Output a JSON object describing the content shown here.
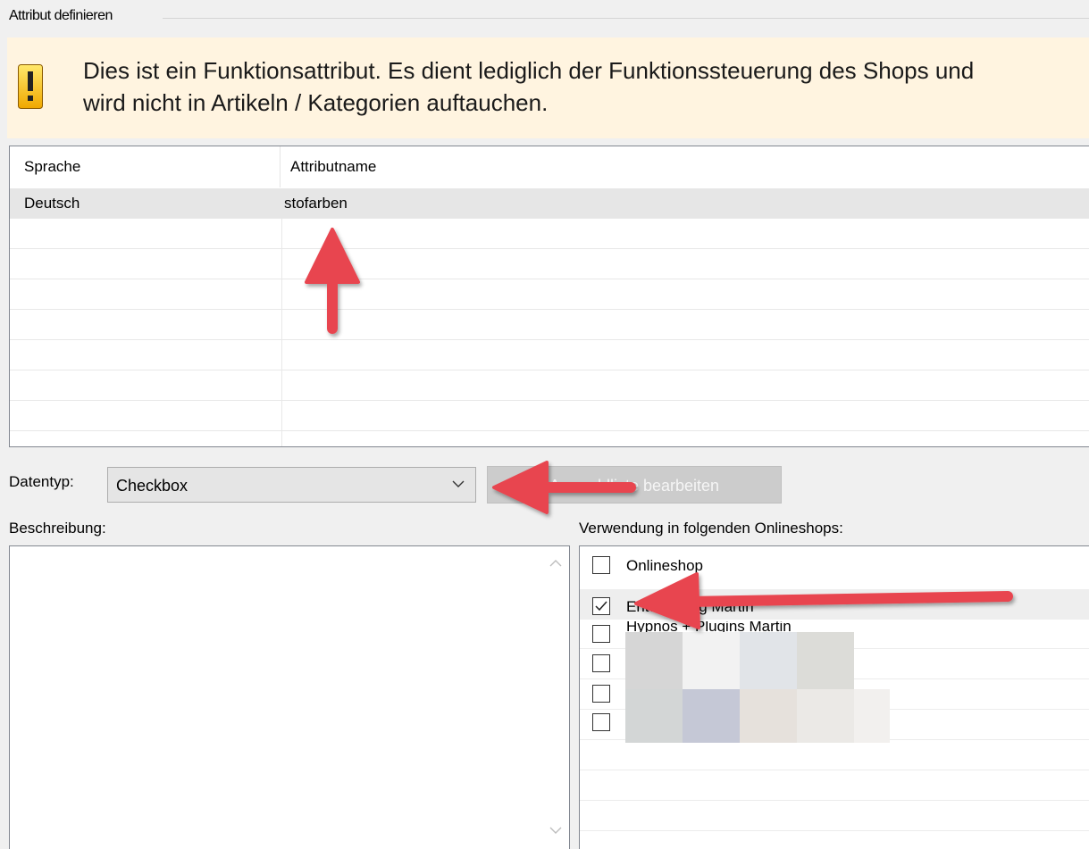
{
  "group": {
    "title": "Attribut definieren"
  },
  "info": {
    "text": "Dies ist ein Funktionsattribut. Es dient lediglich der Funktionssteuerung des Shops und\nwird nicht in Artikeln / Kategorien auftauchen.",
    "banner_color": "#fff4e0"
  },
  "table": {
    "headers": [
      "Sprache",
      "Attributname"
    ],
    "rows": [
      {
        "language": "Deutsch",
        "name": "stofarben"
      }
    ]
  },
  "datentyp": {
    "label": "Datentyp:",
    "value": "Checkbox",
    "button_label": "Auswahlliste bearbeiten"
  },
  "description": {
    "label": "Beschreibung:"
  },
  "shops": {
    "label": "Verwendung in folgenden Onlineshops:",
    "items": [
      {
        "label": "Onlineshop",
        "checked": false
      },
      {
        "label": "Entwicklung Martin",
        "checked": true
      },
      {
        "label": "Hypnos + Plugins Martin",
        "checked": false
      },
      {
        "label": "",
        "checked": false
      },
      {
        "label": "",
        "checked": false
      },
      {
        "label": "",
        "checked": false
      }
    ]
  },
  "colors": {
    "arrow": "#e8454f",
    "selection": "#e6e6e6"
  },
  "icons": [
    "warning-icon",
    "chevron-down-icon",
    "scroll-up-icon",
    "scroll-down-icon",
    "checkmark-icon",
    "annotation-arrow-icon"
  ]
}
